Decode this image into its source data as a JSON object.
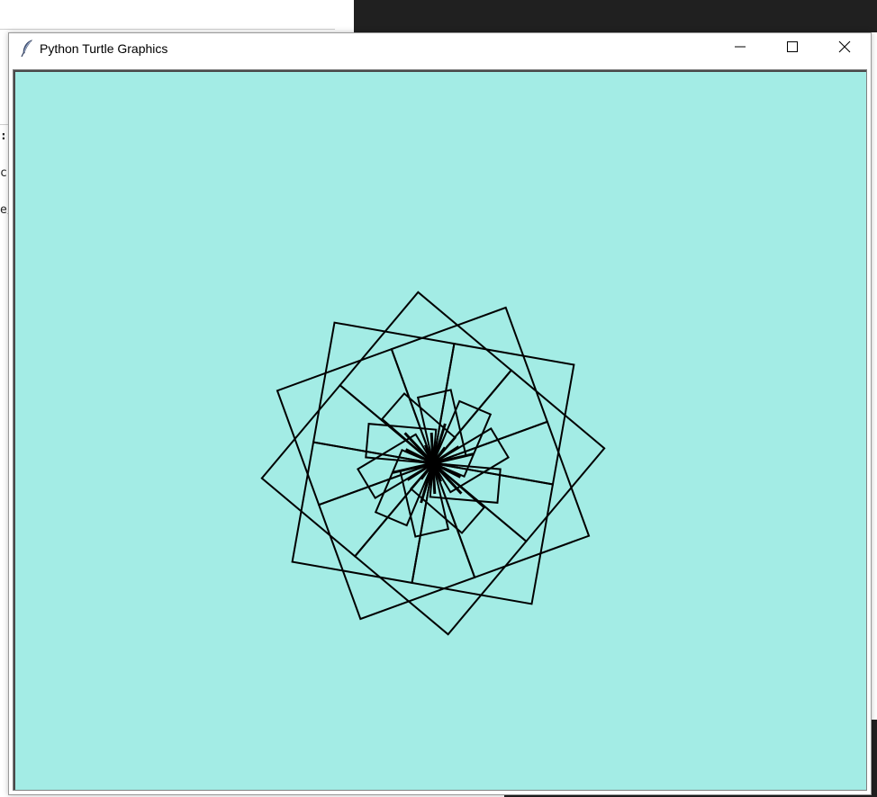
{
  "window": {
    "title": "Python Turtle Graphics",
    "icon": "feather-icon",
    "controls": {
      "minimize": "minimize-icon",
      "maximize": "maximize-icon",
      "close": "close-icon"
    }
  },
  "background_window": {
    "fragments": [
      ":",
      "c",
      "e/"
    ]
  },
  "canvas": {
    "background_color": "#a3ece5",
    "pen_color": "#000000",
    "turtle": "arrow-turtle-icon"
  }
}
